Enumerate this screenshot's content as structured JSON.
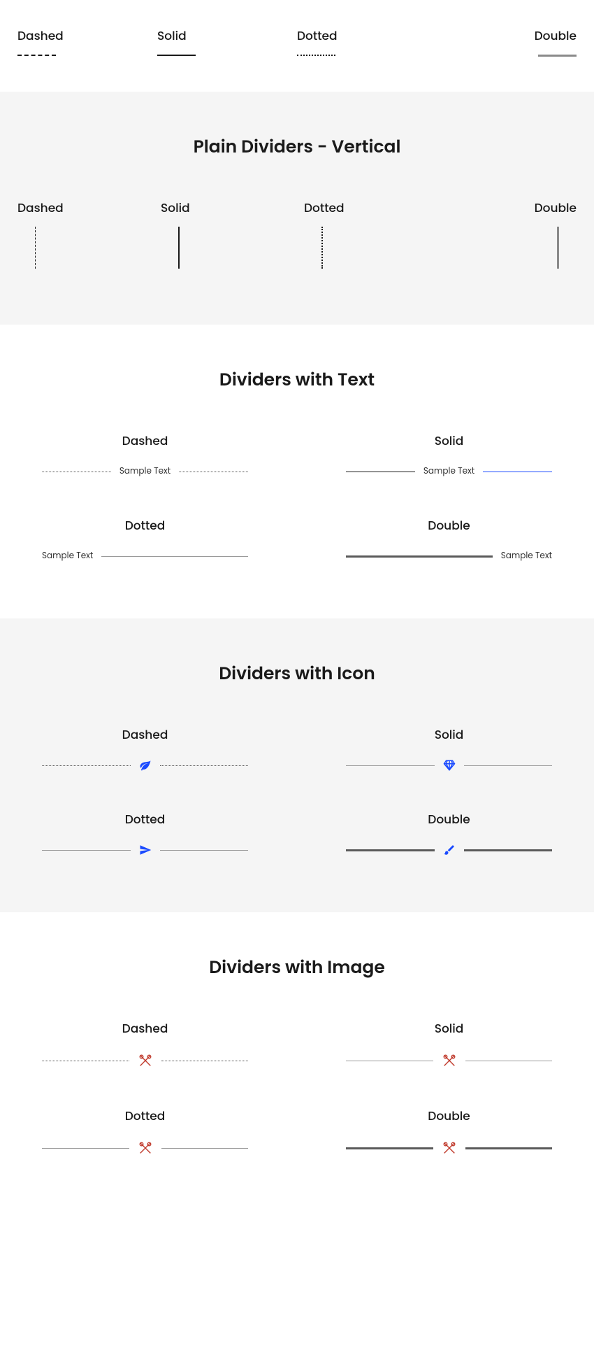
{
  "top_row": {
    "dashed": "Dashed",
    "solid": "Solid",
    "dotted": "Dotted",
    "double": "Double"
  },
  "vertical_section": {
    "title": "Plain Dividers - Vertical",
    "dashed": "Dashed",
    "solid": "Solid",
    "dotted": "Dotted",
    "double": "Double"
  },
  "text_section": {
    "title": "Dividers with Text",
    "dashed": "Dashed",
    "solid": "Solid",
    "dotted": "Dotted",
    "double": "Double",
    "sample": "Sample Text"
  },
  "icon_section": {
    "title": "Dividers with Icon",
    "dashed": "Dashed",
    "solid": "Solid",
    "dotted": "Dotted",
    "double": "Double"
  },
  "image_section": {
    "title": "Dividers with Image",
    "dashed": "Dashed",
    "solid": "Solid",
    "dotted": "Dotted",
    "double": "Double"
  }
}
